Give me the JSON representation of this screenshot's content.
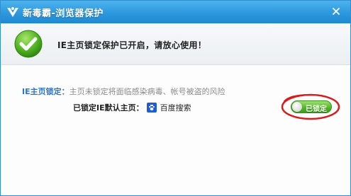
{
  "window": {
    "title": "新毒霸-浏览器保护",
    "brand_color": "#2c98de"
  },
  "header": {
    "status_message": "IE主页锁定保护已开启，请放心使用！"
  },
  "homepage_lock": {
    "label": "IE主页锁定：",
    "description": "主页未锁定将面临感染病毒、帐号被盗的风险",
    "locked_label": "已锁定IE默认主页：",
    "locked_homepage": "百度搜索",
    "toggle_label": "已锁定",
    "toggle_on": true,
    "toggle_color": "#4fb527",
    "highlight_color": "#d81c1c"
  },
  "icons": {
    "app": "kingsoft-duba-logo",
    "close": "close-icon",
    "status": "check-icon",
    "homepage": "baidu-paw-icon"
  }
}
